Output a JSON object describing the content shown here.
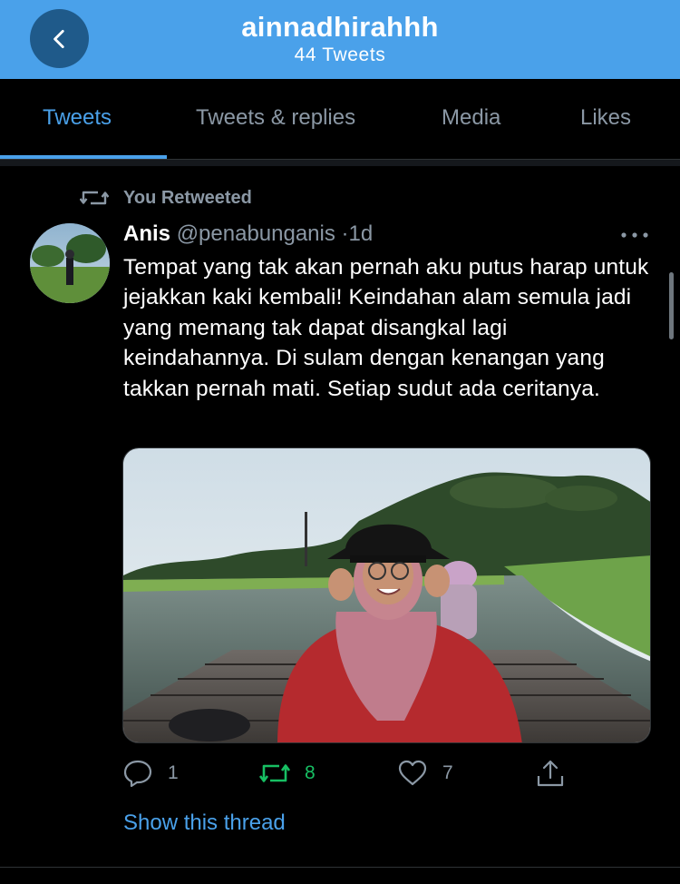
{
  "header": {
    "title": "ainnadhirahhh",
    "subtitle": "44 Tweets",
    "back_icon": "chevron-left-icon"
  },
  "tabs": [
    {
      "label": "Tweets",
      "active": true
    },
    {
      "label": "Tweets & replies",
      "active": false
    },
    {
      "label": "Media",
      "active": false
    },
    {
      "label": "Likes",
      "active": false
    }
  ],
  "tweet": {
    "retweet_label": "You Retweeted",
    "author_name": "Anis",
    "author_handle": "@penabunganis",
    "separator": "·",
    "time": "1d",
    "text": "Tempat yang tak akan pernah aku putus harap untuk jejakkan kaki kembali! Keindahan alam semula jadi yang memang tak dapat disangkal lagi keindahannya. Di sulam dengan kenangan yang takkan pernah mati. Setiap sudut ada ceritanya.",
    "actions": {
      "replies": "1",
      "retweets": "8",
      "likes": "7"
    },
    "show_thread": "Show this thread"
  },
  "colors": {
    "accent": "#4aa1ea",
    "retweet_green": "#17bf63",
    "muted": "#8b98a5",
    "background": "#000000"
  }
}
